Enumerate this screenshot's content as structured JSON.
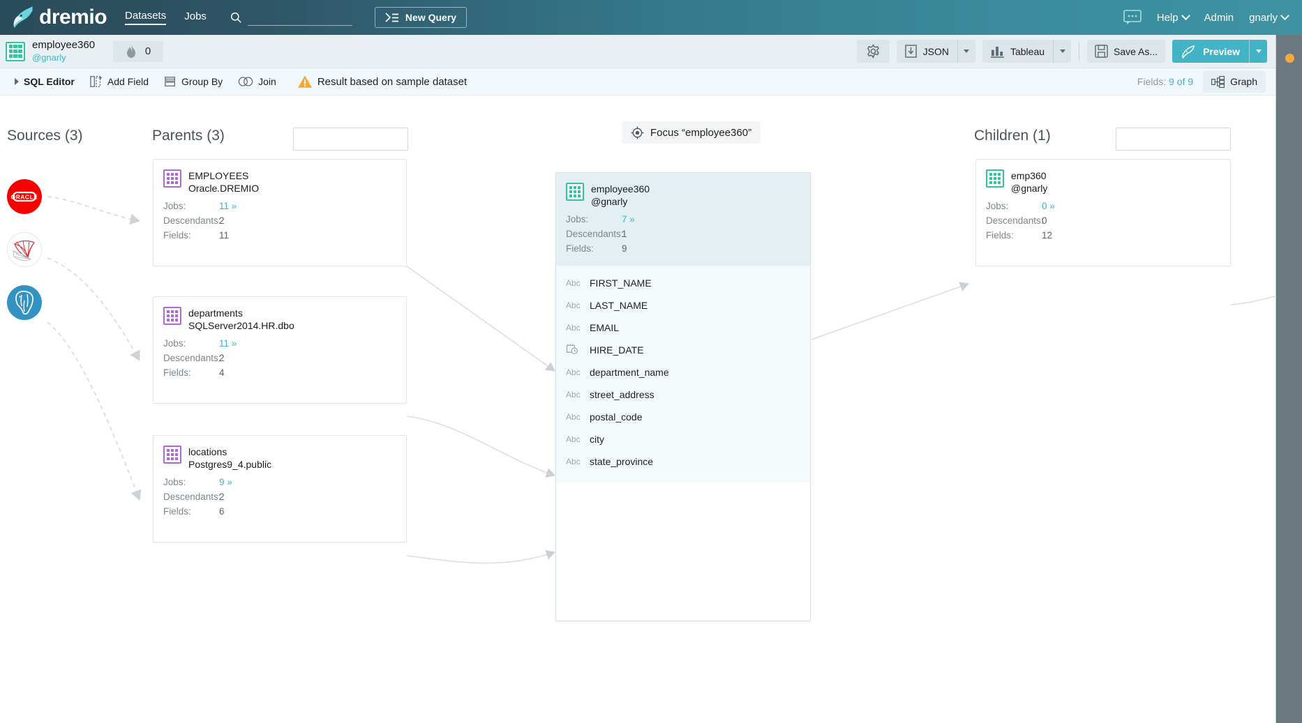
{
  "topnav": {
    "brand": "dremio",
    "links": [
      {
        "label": "Datasets",
        "active": true
      },
      {
        "label": "Jobs",
        "active": false
      }
    ],
    "search_placeholder": "",
    "search_value": "",
    "new_query_label": "New Query",
    "right_items": [
      {
        "label": "",
        "icon": "chat-bubble-icon",
        "caret": false
      },
      {
        "label": "Help",
        "caret": true
      },
      {
        "label": "Admin",
        "caret": false
      },
      {
        "label": "gnarly",
        "caret": true
      }
    ]
  },
  "dataset_toolbar": {
    "icon": "green-grid-icon",
    "title": "employee360",
    "owner": "@gnarly",
    "pin_icon": "flame-icon",
    "pin_count": "0",
    "settings_icon": "gear-icon",
    "export": {
      "icon": "download-icon",
      "label": "JSON"
    },
    "bi_tool": {
      "icon": "bar-chart-icon",
      "label": "Tableau"
    },
    "save_as": {
      "icon": "floppy-disk-icon",
      "label": "Save As..."
    },
    "preview": {
      "icon": "dremio-narwhal-icon",
      "label": "Preview"
    }
  },
  "sub_toolbar": {
    "items": [
      {
        "label": "SQL Editor",
        "icon": "triangle-right-icon",
        "bold": true
      },
      {
        "label": "Add Field",
        "icon": "add-field-icon",
        "bold": false
      },
      {
        "label": "Group By",
        "icon": "group-by-icon",
        "bold": false
      },
      {
        "label": "Join",
        "icon": "join-icon",
        "bold": false
      },
      {
        "label": "Result based on sample dataset",
        "icon": "warning-icon",
        "bold": false
      }
    ],
    "fields_label": "Fields:",
    "fields_value": "9 of 9",
    "graph_label": "Graph",
    "graph_icon": "graph-icon"
  },
  "graph": {
    "focus_button": {
      "icon": "focus-target-icon",
      "label": "Focus “employee360”"
    },
    "sources": {
      "header": "Sources (3)",
      "items": [
        {
          "name": "oracle-source-icon",
          "label": "ORACLE"
        },
        {
          "name": "sqlserver-source-icon",
          "label": ""
        },
        {
          "name": "postgres-source-icon",
          "label": ""
        }
      ]
    },
    "parents": {
      "header": "Parents (3)",
      "search_placeholder": "",
      "search_value": "",
      "cards": [
        {
          "name": "EMPLOYEES",
          "path": "Oracle.DREMIO",
          "jobs_label": "Jobs:",
          "jobs": "11",
          "descendants_label": "Descendants:",
          "descendants": "2",
          "fields_label": "Fields:",
          "fields": "11"
        },
        {
          "name": "departments",
          "path": "SQLServer2014.HR.dbo",
          "jobs_label": "Jobs:",
          "jobs": "11",
          "descendants_label": "Descendants:",
          "descendants": "2",
          "fields_label": "Fields:",
          "fields": "4"
        },
        {
          "name": "locations",
          "path": "Postgres9_4.public",
          "jobs_label": "Jobs:",
          "jobs": "9",
          "descendants_label": "Descendants:",
          "descendants": "2",
          "fields_label": "Fields:",
          "fields": "6"
        }
      ]
    },
    "center": {
      "name": "employee360",
      "path": "@gnarly",
      "jobs_label": "Jobs:",
      "jobs": "7",
      "descendants_label": "Descendants:",
      "descendants": "1",
      "fields_label": "Fields:",
      "fields": "9",
      "field_list": [
        {
          "type": "Abc",
          "name": "FIRST_NAME"
        },
        {
          "type": "Abc",
          "name": "LAST_NAME"
        },
        {
          "type": "Abc",
          "name": "EMAIL"
        },
        {
          "type": "date",
          "name": "HIRE_DATE"
        },
        {
          "type": "Abc",
          "name": "department_name"
        },
        {
          "type": "Abc",
          "name": "street_address"
        },
        {
          "type": "Abc",
          "name": "postal_code"
        },
        {
          "type": "Abc",
          "name": "city"
        },
        {
          "type": "Abc",
          "name": "state_province"
        }
      ]
    },
    "children": {
      "header": "Children (1)",
      "search_placeholder": "",
      "search_value": "",
      "cards": [
        {
          "name": "emp360",
          "path": "@gnarly",
          "jobs_label": "Jobs:",
          "jobs": "0",
          "descendants_label": "Descendants:",
          "descendants": "0",
          "fields_label": "Fields:",
          "fields": "12"
        }
      ]
    }
  },
  "colors": {
    "nav_start": "#2a4b59",
    "nav_end": "#3e92a1",
    "accent_teal": "#43b0c9",
    "preview_btn": "#42b4c6",
    "green_icon": "#2fc7a1",
    "purple_icon": "#b06ad1",
    "warning_orange": "#f5a93f",
    "right_panel": "#6b7880"
  }
}
